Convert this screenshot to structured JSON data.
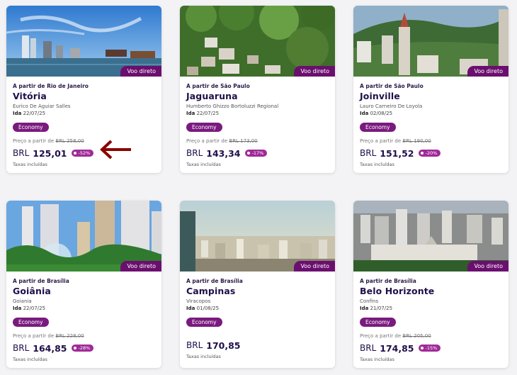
{
  "cards": [
    {
      "badge": "Voo direto",
      "from": "A partir de Rio de Janeiro",
      "city": "Vitória",
      "airport": "Eurico De Aguiar Salles",
      "date_label": "Ida",
      "date": "22/07/25",
      "cabin": "Economy",
      "price_from_label": "Preço a partir de",
      "old_price": "BRL  258,00",
      "currency": "BRL",
      "price": "125,01",
      "discount": "-52%",
      "taxes": "Taxas incluídas"
    },
    {
      "badge": "Voo direto",
      "from": "A partir de São Paulo",
      "city": "Jaguaruna",
      "airport": "Humberto Ghizzo Bortoluzzi Regional",
      "date_label": "Ida",
      "date": "22/07/25",
      "cabin": "Economy",
      "price_from_label": "Preço a partir de",
      "old_price": "BRL  173,00",
      "currency": "BRL",
      "price": "143,34",
      "discount": "-17%",
      "taxes": "Taxas incluídas"
    },
    {
      "badge": "Voo direto",
      "from": "A partir de São Paulo",
      "city": "Joinville",
      "airport": "Lauro Carneiro De Loyola",
      "date_label": "Ida",
      "date": "02/08/25",
      "cabin": "Economy",
      "price_from_label": "Preço a partir de",
      "old_price": "BRL  190,00",
      "currency": "BRL",
      "price": "151,52",
      "discount": "-20%",
      "taxes": "Taxas incluídas"
    },
    {
      "badge": "Voo direto",
      "from": "A partir de Brasília",
      "city": "Goiânia",
      "airport": "Goiania",
      "date_label": "Ida",
      "date": "22/07/25",
      "cabin": "Economy",
      "price_from_label": "Preço a partir de",
      "old_price": "BRL  228,00",
      "currency": "BRL",
      "price": "164,85",
      "discount": "-28%",
      "taxes": "Taxas incluídas"
    },
    {
      "badge": "Voo direto",
      "from": "A partir de Brasília",
      "city": "Campinas",
      "airport": "Viracopos",
      "date_label": "Ida",
      "date": "01/08/25",
      "cabin": "Economy",
      "price_from_label": "",
      "old_price": "",
      "currency": "BRL",
      "price": "170,85",
      "discount": "",
      "taxes": "Taxas incluídas"
    },
    {
      "badge": "Voo direto",
      "from": "A partir de Brasília",
      "city": "Belo Horizonte",
      "airport": "Confins",
      "date_label": "Ida",
      "date": "21/07/25",
      "cabin": "Economy",
      "price_from_label": "Preço a partir de",
      "old_price": "BRL  205,00",
      "currency": "BRL",
      "price": "174,85",
      "discount": "-15%",
      "taxes": "Taxas incluídas"
    }
  ],
  "colors": {
    "brand": "#6b0f6f",
    "discount": "#a02a98",
    "title": "#1f0f4a",
    "arrow": "#8b0000"
  },
  "annotation": {
    "icon": "left-arrow-icon"
  }
}
